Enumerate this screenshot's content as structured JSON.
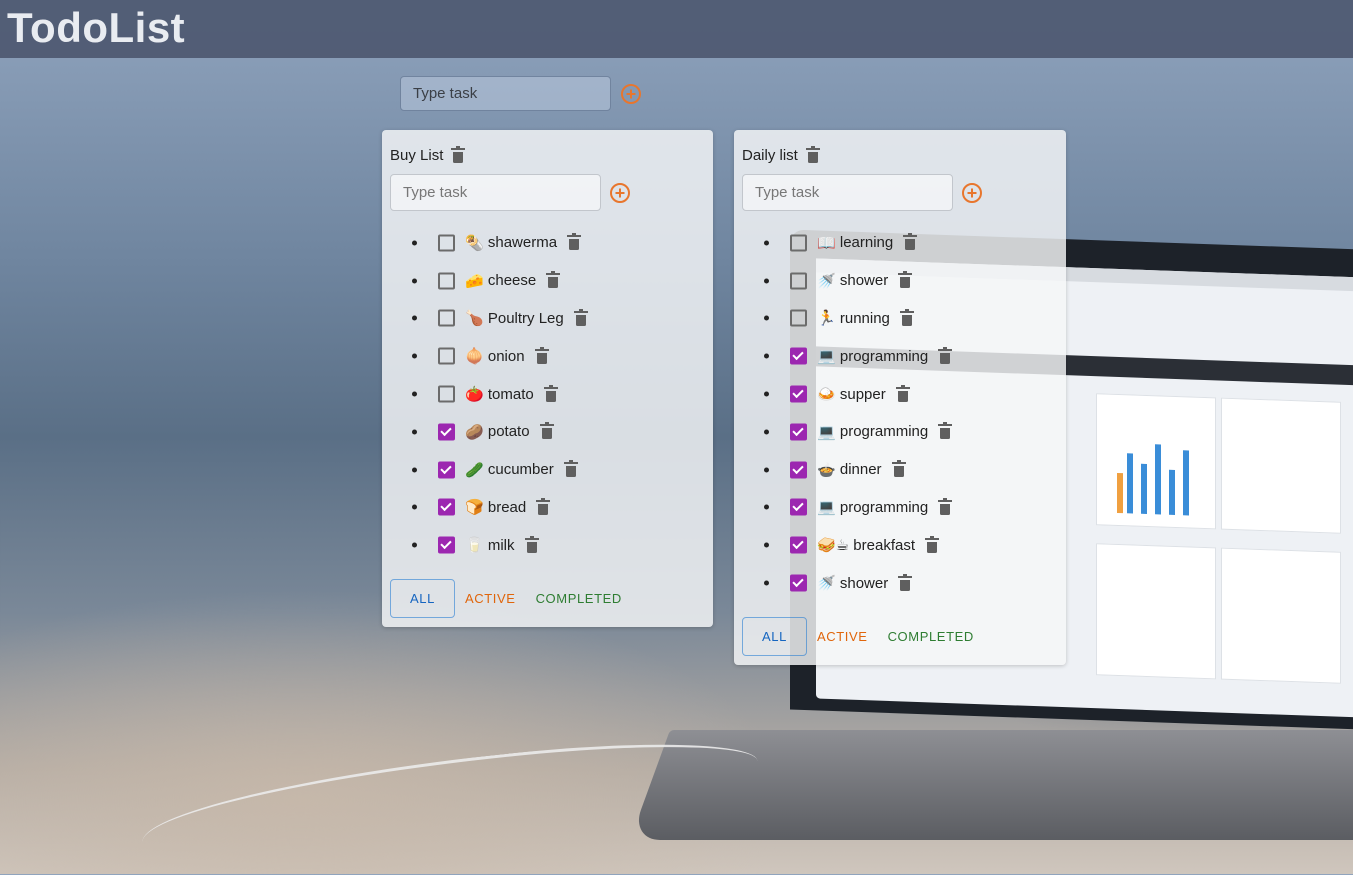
{
  "app": {
    "title": "TodoList"
  },
  "new_list": {
    "placeholder": "Type task"
  },
  "lists": [
    {
      "title": "Buy List",
      "input_placeholder": "Type task",
      "tasks": [
        {
          "emoji": "🌯",
          "text": "shawerma",
          "done": false
        },
        {
          "emoji": "🧀",
          "text": "cheese",
          "done": false
        },
        {
          "emoji": "🍗",
          "text": "Poultry Leg",
          "done": false
        },
        {
          "emoji": "🧅",
          "text": "onion",
          "done": false
        },
        {
          "emoji": "🍅",
          "text": "tomato",
          "done": false
        },
        {
          "emoji": "🥔",
          "text": "potato",
          "done": true
        },
        {
          "emoji": "🥒",
          "text": "cucumber",
          "done": true
        },
        {
          "emoji": "🍞",
          "text": "bread",
          "done": true
        },
        {
          "emoji": "🥛",
          "text": "milk",
          "done": true
        }
      ],
      "filters": {
        "all": "ALL",
        "active": "ACTIVE",
        "completed": "COMPLETED"
      }
    },
    {
      "title": "Daily list",
      "input_placeholder": "Type task",
      "tasks": [
        {
          "emoji": "📖",
          "text": "learning",
          "done": false
        },
        {
          "emoji": "🚿",
          "text": "shower",
          "done": false
        },
        {
          "emoji": "🏃",
          "text": "running",
          "done": false
        },
        {
          "emoji": "💻",
          "text": "programming",
          "done": true
        },
        {
          "emoji": "🍛",
          "text": "supper",
          "done": true
        },
        {
          "emoji": "💻",
          "text": "programming",
          "done": true
        },
        {
          "emoji": "🍲",
          "text": "dinner",
          "done": true
        },
        {
          "emoji": "💻",
          "text": "programming",
          "done": true
        },
        {
          "emoji": "🥪☕",
          "text": "breakfast",
          "done": true
        },
        {
          "emoji": "🚿",
          "text": "shower",
          "done": true
        }
      ],
      "filters": {
        "all": "ALL",
        "active": "ACTIVE",
        "completed": "COMPLETED"
      }
    }
  ],
  "colors": {
    "accent_add": "#e8762d",
    "checkbox_checked": "#9c27b0",
    "filter_all": "#1565c0",
    "filter_active": "#e0650b",
    "filter_completed": "#2e7d32"
  }
}
